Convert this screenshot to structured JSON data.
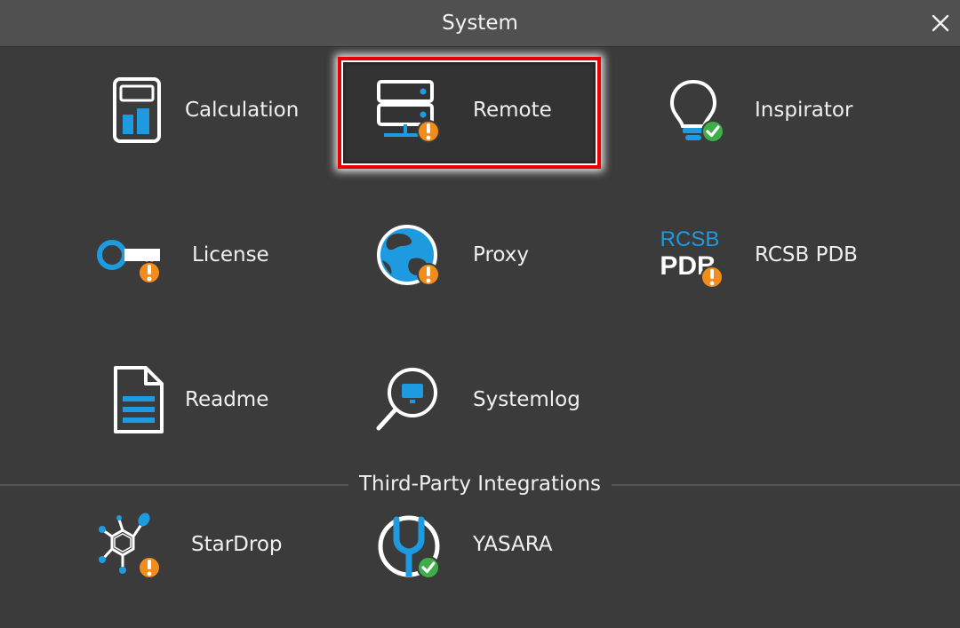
{
  "window": {
    "title": "System"
  },
  "tiles": [
    {
      "label": "Calculation",
      "icon": "calculator-icon",
      "status": null
    },
    {
      "label": "Remote",
      "icon": "server-icon",
      "status": "warning",
      "selected": true
    },
    {
      "label": "Inspirator",
      "icon": "lightbulb-icon",
      "status": "ok"
    },
    {
      "label": "License",
      "icon": "key-icon",
      "status": "warning"
    },
    {
      "label": "Proxy",
      "icon": "globe-icon",
      "status": "warning"
    },
    {
      "label": "RCSB PDB",
      "icon": "rcsb-pdb-logo",
      "status": "warning",
      "logo_text_top": "RCSB",
      "logo_text_bottom": "PDB"
    },
    {
      "label": "Readme",
      "icon": "document-icon",
      "status": null
    },
    {
      "label": "Systemlog",
      "icon": "magnifier-monitor-icon",
      "status": null
    }
  ],
  "third_party": {
    "title": "Third-Party Integrations",
    "tiles": [
      {
        "label": "StarDrop",
        "icon": "molecule-icon",
        "status": "warning"
      },
      {
        "label": "YASARA",
        "icon": "yasara-icon",
        "status": "ok"
      }
    ]
  },
  "colors": {
    "background": "#3b3b3b",
    "titlebar": "#505050",
    "accent_blue": "#1e9be0",
    "warning": "#f28c1c",
    "ok": "#3fae49",
    "selection": "#e60000"
  }
}
